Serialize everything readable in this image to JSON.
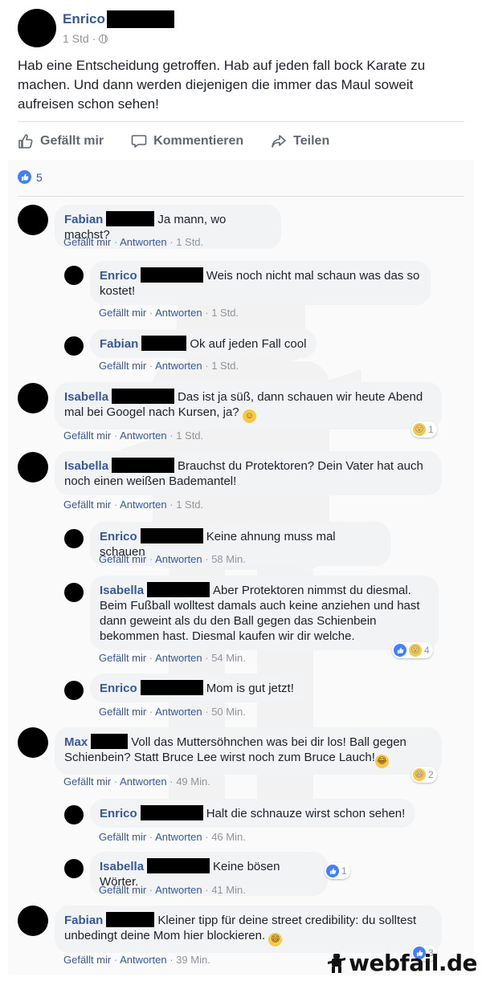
{
  "post": {
    "author": "Enrico",
    "time": "1 Std",
    "separator": "·",
    "text": "Hab eine Entscheidung getroffen. Hab auf jeden fall bock Karate zu machen. Und dann werden diejenigen die immer das Maul soweit aufreisen schon sehen!",
    "actions": {
      "like": "Gefällt mir",
      "comment": "Kommentieren",
      "share": "Teilen"
    },
    "like_count": "5"
  },
  "comments": [
    {
      "name": "Fabian",
      "text": "Ja mann, wo machst?",
      "like": "Gefällt mir",
      "reply": "Antworten",
      "time": "1 Std."
    },
    {
      "name": "Enrico",
      "text": "Weis noch nicht mal schaun was das so kostet!",
      "like": "Gefällt mir",
      "reply": "Antworten",
      "time": "1 Std."
    },
    {
      "name": "Fabian",
      "text": "Ok auf jeden Fall cool",
      "like": "Gefällt mir",
      "reply": "Antworten",
      "time": "1 Std."
    },
    {
      "name": "Isabella",
      "text": "Das ist ja süß, dann schauen wir heute Abend mal bei Googel nach Kursen, ja?",
      "like": "Gefällt mir",
      "reply": "Antworten",
      "time": "1 Std.",
      "reactions": "1"
    },
    {
      "name": "Isabella",
      "text": "Brauchst du Protektoren? Dein Vater hat auch noch einen weißen Bademantel!",
      "like": "Gefällt mir",
      "reply": "Antworten",
      "time": "1 Std."
    },
    {
      "name": "Enrico",
      "text": "Keine ahnung muss mal schauen",
      "like": "Gefällt mir",
      "reply": "Antworten",
      "time": "58 Min."
    },
    {
      "name": "Isabella",
      "text": "Aber Protektoren nimmst du diesmal. Beim Fußball wolltest damals auch keine anziehen und hast dann geweint als du den Ball gegen das Schienbein bekommen hast. Diesmal kaufen wir dir welche.",
      "like": "Gefällt mir",
      "reply": "Antworten",
      "time": "54 Min.",
      "reactions": "4"
    },
    {
      "name": "Enrico",
      "text": "Mom is gut jetzt!",
      "like": "Gefällt mir",
      "reply": "Antworten",
      "time": "50 Min."
    },
    {
      "name": "Max",
      "text": "Voll das Muttersöhnchen was bei dir los! Ball gegen Schienbein? Statt Bruce Lee wirst noch zum Bruce Lauch!",
      "like": "Gefällt mir",
      "reply": "Antworten",
      "time": "49 Min.",
      "reactions": "2"
    },
    {
      "name": "Enrico",
      "text": "Halt die schnauze wirst schon sehen!",
      "like": "Gefällt mir",
      "reply": "Antworten",
      "time": "46 Min."
    },
    {
      "name": "Isabella",
      "text": "Keine bösen Wörter.",
      "like": "Gefällt mir",
      "reply": "Antworten",
      "time": "41 Min.",
      "reactions": "1"
    },
    {
      "name": "Fabian",
      "text": "Kleiner tipp für deine street credibility: du solltest unbedingt deine Mom hier blockieren.",
      "like": "Gefällt mir",
      "reply": "Antworten",
      "time": "39 Min.",
      "reactions": "3"
    }
  ],
  "meta_sep": " · ",
  "watermark": "webfail.de",
  "colors": {
    "link": "#385898",
    "muted": "#90949c",
    "bubble": "#f2f3f5",
    "like_blue": "#4080ff",
    "emoji": "#f7c94b"
  },
  "icons": [
    "thumbs-up-icon",
    "comment-icon",
    "share-icon",
    "globe-icon",
    "wow-emoji-icon",
    "haha-emoji-icon",
    "smile-emoji-icon"
  ]
}
